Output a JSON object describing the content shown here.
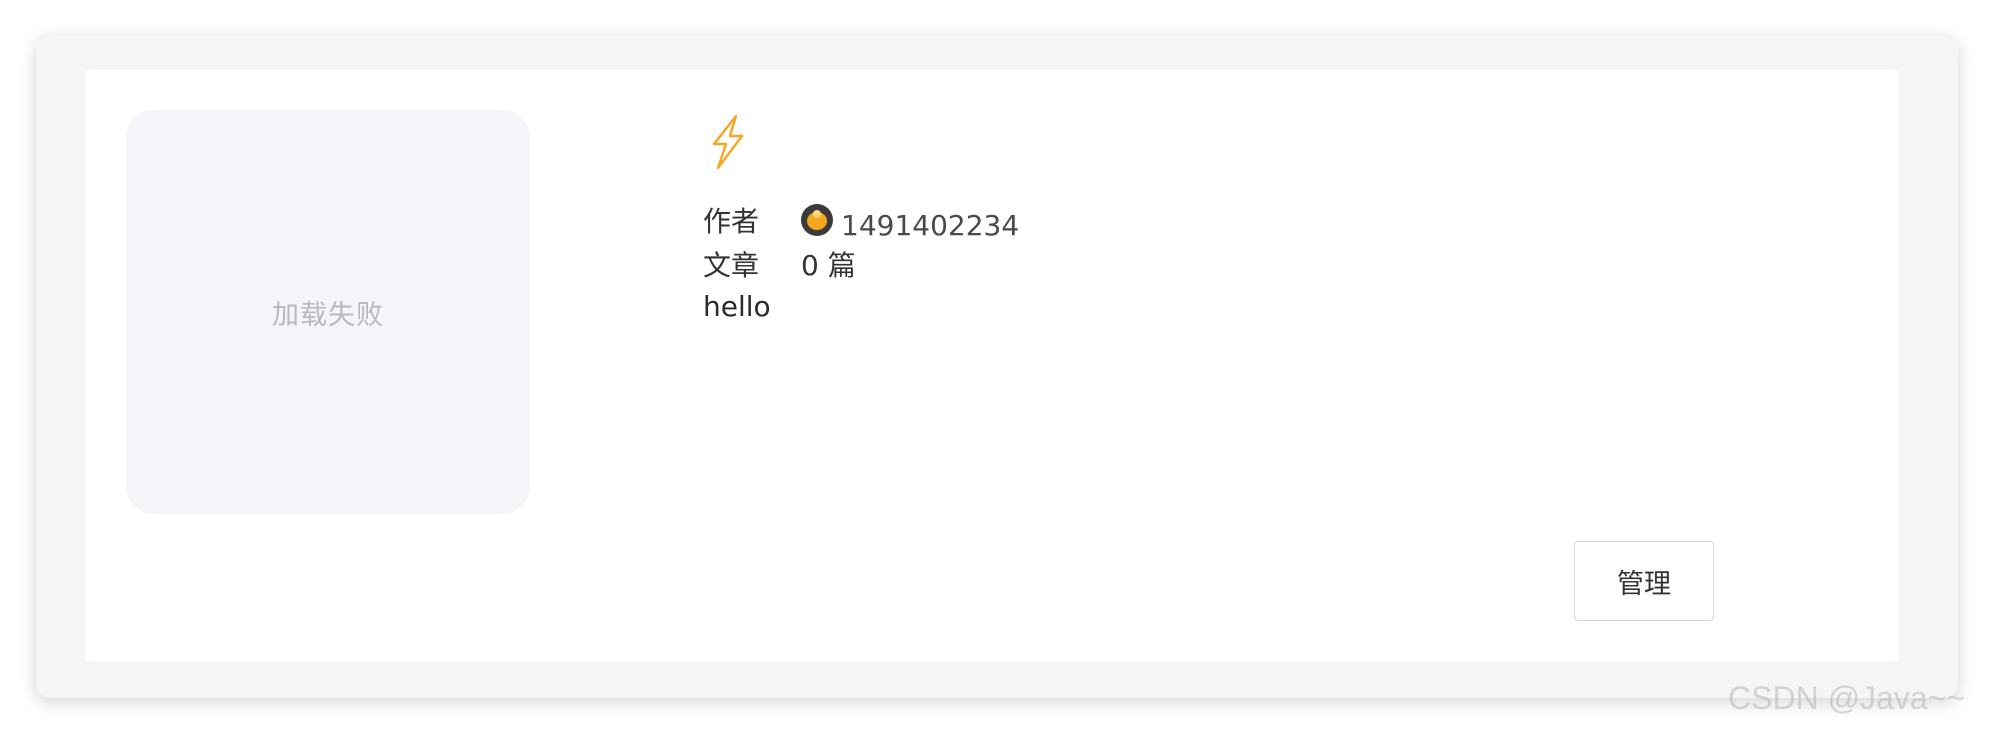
{
  "cover": {
    "status_text": "加载失败"
  },
  "header_icon": "flash-icon",
  "meta": {
    "author_label": "作者",
    "author_name": "1491402234",
    "articles_label": "文章",
    "article_count": "0 篇",
    "description": "hello"
  },
  "actions": {
    "manage_label": "管理"
  },
  "watermark": "CSDN @Java~~",
  "colors": {
    "panel_bg": "#f4f5f7",
    "card_bg": "#ffffff",
    "icon_accent": "#f5a623",
    "text_primary": "#333333",
    "placeholder_text": "#b6b9bf"
  }
}
